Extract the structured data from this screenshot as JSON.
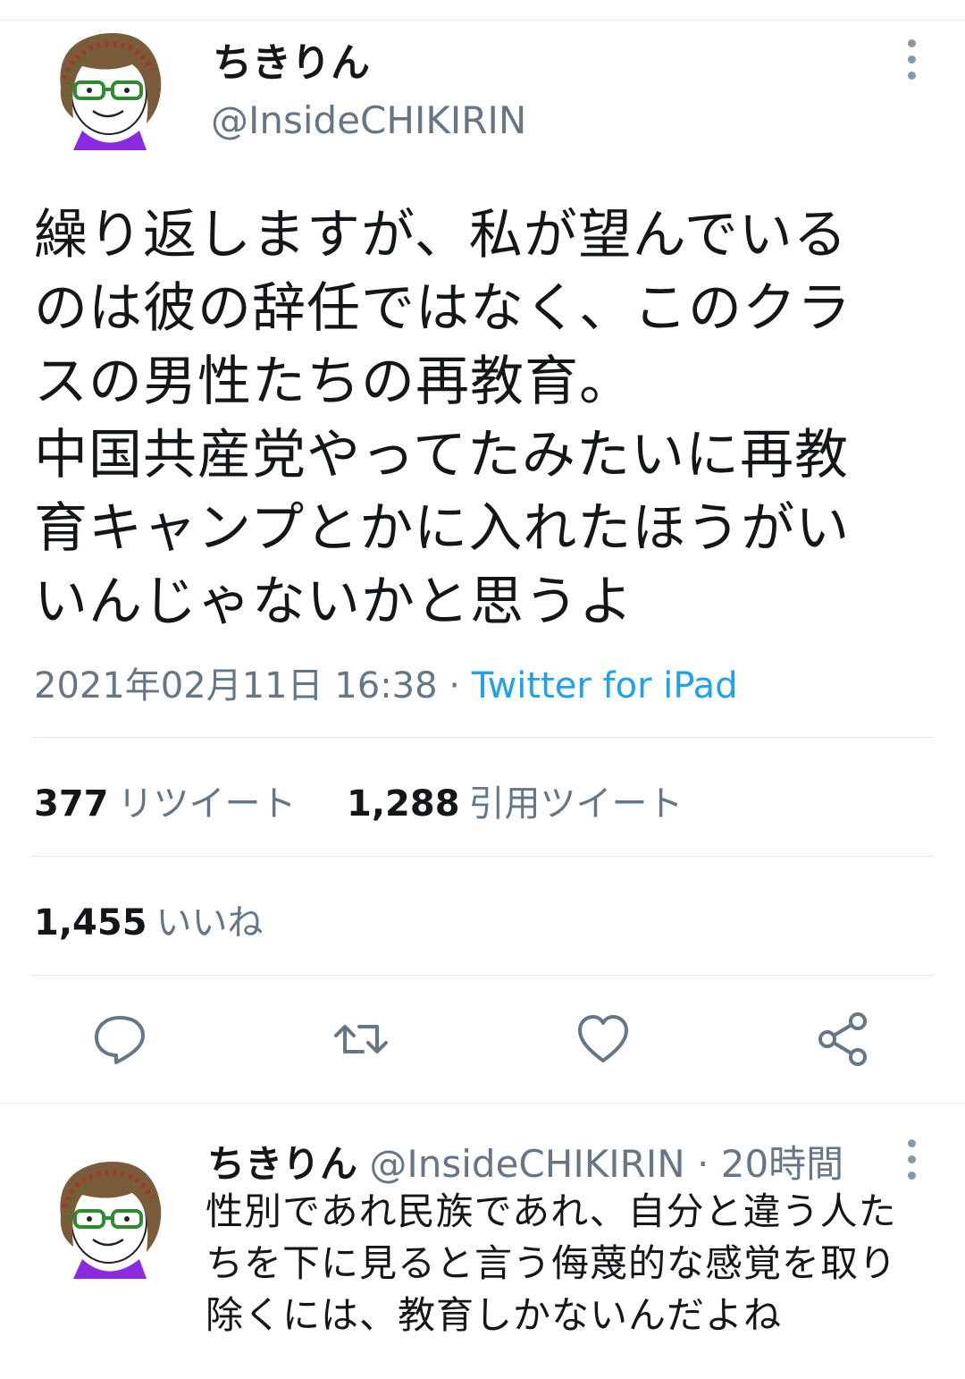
{
  "tweet": {
    "author_name": "ちきりん",
    "author_handle": "@InsideCHIKIRIN",
    "text": "繰り返しますが、私が望んでいる\nのは彼の辞任ではなく、このクラ\nスの男性たちの再教育。\n中国共産党やってたみたいに再教\n育キャンプとかに入れたほうがい\nいんじゃないかと思うよ",
    "timestamp": "2021年02月11日 16:38",
    "separator": " · ",
    "source": "Twitter for iPad"
  },
  "stats": {
    "retweets": {
      "count": "377",
      "label": "リツイート"
    },
    "quotes": {
      "count": "1,288",
      "label": "引用ツイート"
    },
    "likes": {
      "count": "1,455",
      "label": "いいね"
    }
  },
  "actions": {
    "icons": [
      "reply-icon",
      "retweet-icon",
      "like-icon",
      "share-icon"
    ]
  },
  "reply": {
    "author_name": "ちきりん",
    "author_handle": "@InsideCHIKIRIN",
    "dot": " · ",
    "time": "20時間",
    "text": "性別であれ民族であれ、自分と違う人た\nちを下に見ると言う侮蔑的な感覚を取り\n除くには、教育しかないんだよね"
  },
  "colors": {
    "secondary_text": "#657786",
    "link": "#1da1f2",
    "divider": "#e1e8ed",
    "icon": "#657786"
  }
}
